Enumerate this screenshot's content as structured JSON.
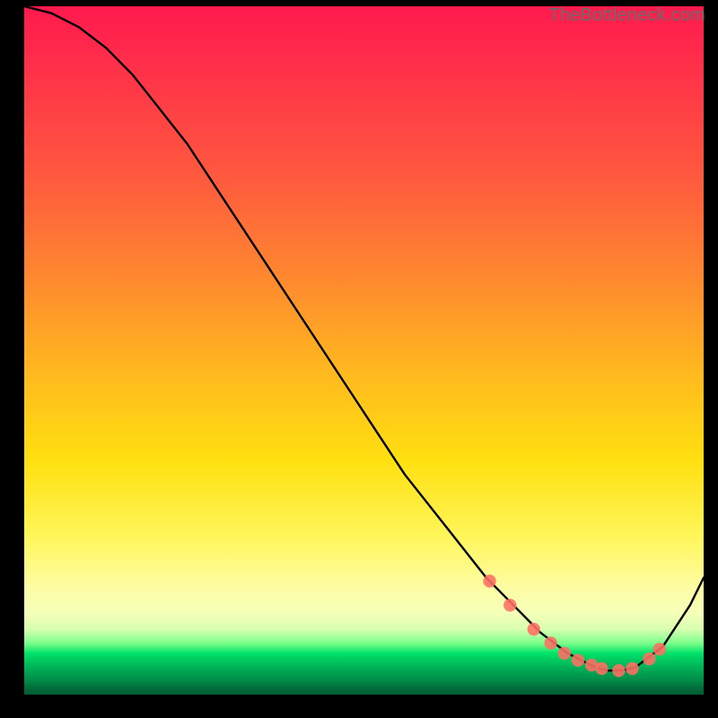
{
  "watermark": "TheBottleneck.com",
  "colors": {
    "marker_fill": "#ff6e63",
    "curve_stroke": "#000000"
  },
  "chart_data": {
    "type": "line",
    "title": "",
    "xlabel": "",
    "ylabel": "",
    "xlim": [
      0,
      100
    ],
    "ylim": [
      0,
      100
    ],
    "grid": false,
    "series": [
      {
        "name": "bottleneck-curve",
        "x": [
          0,
          4,
          8,
          12,
          16,
          20,
          24,
          28,
          32,
          36,
          40,
          44,
          48,
          52,
          56,
          60,
          64,
          68,
          72,
          76,
          80,
          82,
          84,
          86,
          88,
          90,
          94,
          98,
          100
        ],
        "values": [
          100,
          99,
          97,
          94,
          90,
          85,
          80,
          74,
          68,
          62,
          56,
          50,
          44,
          38,
          32,
          27,
          22,
          17,
          13,
          9,
          6,
          5,
          4,
          3.5,
          3.5,
          4,
          7,
          13,
          17
        ]
      }
    ],
    "markers": [
      {
        "x": 68.5,
        "y": 16.5
      },
      {
        "x": 71.5,
        "y": 13.0
      },
      {
        "x": 75.0,
        "y": 9.5
      },
      {
        "x": 77.5,
        "y": 7.5
      },
      {
        "x": 79.5,
        "y": 6.0
      },
      {
        "x": 81.5,
        "y": 5.0
      },
      {
        "x": 83.5,
        "y": 4.3
      },
      {
        "x": 85.0,
        "y": 3.8
      },
      {
        "x": 87.5,
        "y": 3.5
      },
      {
        "x": 89.5,
        "y": 3.8
      },
      {
        "x": 92.0,
        "y": 5.2
      },
      {
        "x": 93.5,
        "y": 6.6
      }
    ]
  }
}
